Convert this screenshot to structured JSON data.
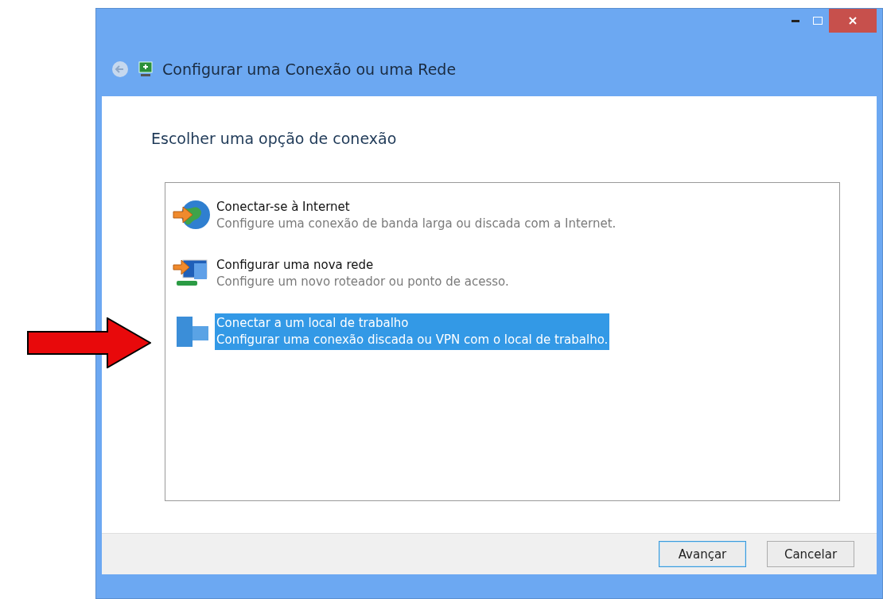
{
  "window": {
    "title": "Configurar uma Conexão ou uma Rede"
  },
  "heading": "Escolher uma opção de conexão",
  "options": [
    {
      "kind": "internet",
      "title": "Conectar-se à Internet",
      "description": "Configure uma conexão de banda larga ou discada com a Internet.",
      "selected": false
    },
    {
      "kind": "network",
      "title": "Configurar uma nova rede",
      "description": "Configure um novo roteador ou ponto de acesso.",
      "selected": false
    },
    {
      "kind": "workplace",
      "title": "Conectar a um local de trabalho",
      "description": "Configurar uma conexão discada ou VPN com o local de trabalho.",
      "selected": true
    }
  ],
  "buttons": [
    {
      "label": "Avançar",
      "default": true
    },
    {
      "label": "Cancelar",
      "default": false
    }
  ]
}
